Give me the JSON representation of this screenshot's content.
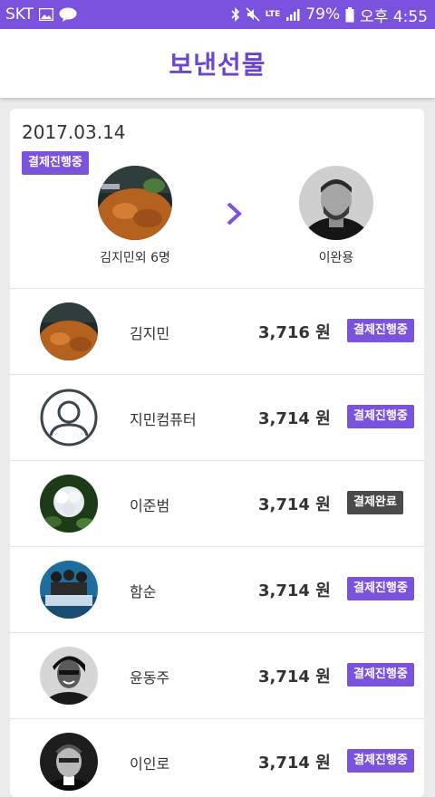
{
  "status_bar": {
    "carrier": "SKT",
    "network": "LTE",
    "battery": "79%",
    "time": "오후 4:55"
  },
  "header": {
    "title": "보낸선물"
  },
  "gift": {
    "date": "2017.03.14",
    "status": "결제진행중",
    "sender_label": "김지민외 6명",
    "recipient_label": "이완용"
  },
  "recipients": [
    {
      "name": "김지민",
      "amount": "3,716 원",
      "status": "결제진행중",
      "avatar": "food"
    },
    {
      "name": "지민컴퓨터",
      "amount": "3,714 원",
      "status": "결제진행중",
      "avatar": "default"
    },
    {
      "name": "이준범",
      "amount": "3,714 원",
      "status": "결제완료",
      "avatar": "flower"
    },
    {
      "name": "함순",
      "amount": "3,714 원",
      "status": "결제진행중",
      "avatar": "band"
    },
    {
      "name": "윤동주",
      "amount": "3,714 원",
      "status": "결제진행중",
      "avatar": "woman"
    },
    {
      "name": "이인로",
      "amount": "3,714 원",
      "status": "결제진행중",
      "avatar": "man"
    }
  ],
  "colors": {
    "accent": "#7b52dd",
    "title": "#6a46cf",
    "done_badge": "#4a4a4a"
  }
}
